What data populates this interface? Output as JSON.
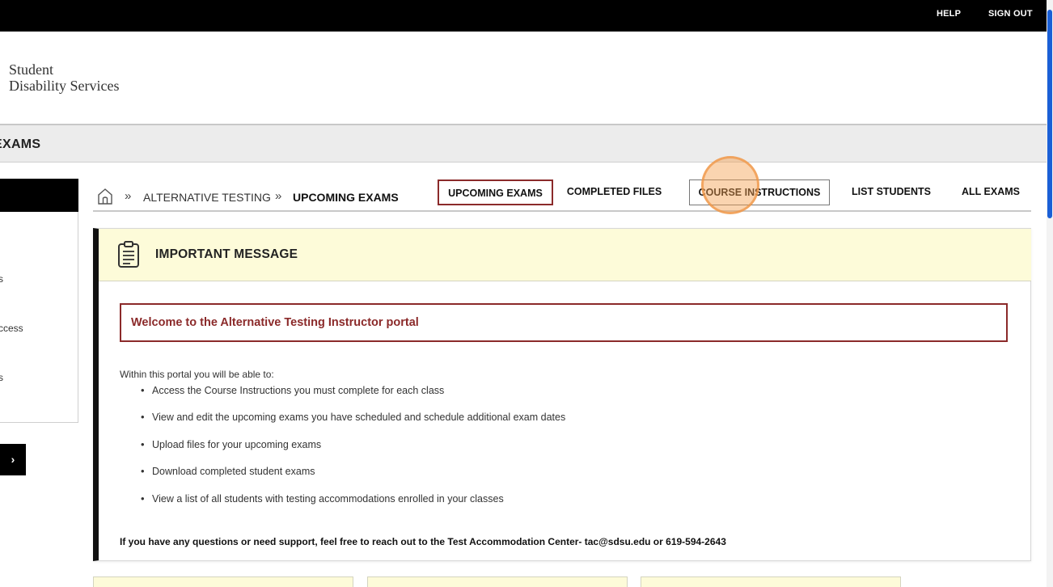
{
  "topbar": {
    "help": "HELP",
    "signout": "SIGN OUT"
  },
  "logo": {
    "line1": "Student",
    "line2": "Disability Services"
  },
  "section": {
    "title": "EXAMS"
  },
  "sidebar": {
    "items": [
      {
        "label": "s"
      },
      {
        "label": "ccess"
      },
      {
        "label": "s"
      }
    ],
    "next_button": "›"
  },
  "breadcrumb": {
    "separator": "»",
    "parent": "ALTERNATIVE TESTING",
    "current": "UPCOMING EXAMS"
  },
  "tabs": [
    {
      "label": "UPCOMING EXAMS",
      "state": "active"
    },
    {
      "label": "COMPLETED FILES",
      "state": "normal"
    },
    {
      "label": "COURSE INSTRUCTIONS",
      "state": "hover"
    },
    {
      "label": "LIST STUDENTS",
      "state": "normal"
    },
    {
      "label": "ALL EXAMS",
      "state": "normal"
    }
  ],
  "message": {
    "title": "IMPORTANT MESSAGE",
    "welcome": "Welcome to the Alternative Testing Instructor portal",
    "intro": "Within this portal you will be able to:",
    "bullets": [
      "Access the Course Instructions you must complete for each class",
      "View and edit the upcoming exams you have scheduled and schedule additional exam dates",
      "Upload files for your upcoming exams",
      "Download completed student exams",
      "View a list of all students with testing accommodations enrolled in your classes"
    ],
    "support": "If you have any questions or need support, feel free to reach out to the Test Accommodation Center- tac@sdsu.edu or 619-594-2643"
  },
  "colors": {
    "accent": "#8b2a2a",
    "message_bg": "#fdfbd9",
    "scrollbar": "#1a5fd6"
  },
  "icons": {
    "home": "home-icon",
    "clipboard": "clipboard-icon"
  }
}
